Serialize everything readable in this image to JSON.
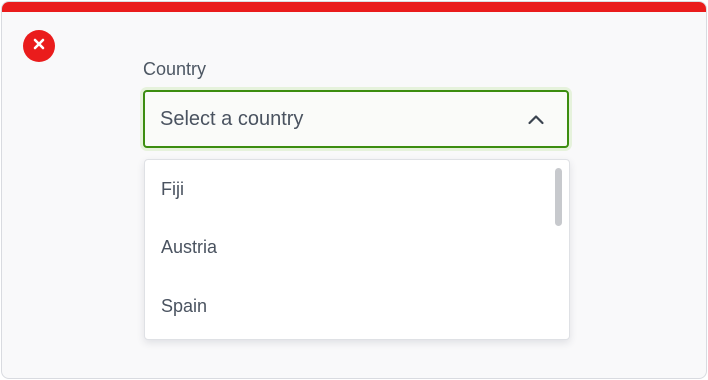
{
  "form": {
    "status_icon": "close-icon",
    "country_label": "Country",
    "select": {
      "value": "Select a country",
      "expanded": true,
      "chevron_icon": "chevron-up-icon"
    },
    "options": [
      {
        "label": "Fiji"
      },
      {
        "label": "Austria"
      },
      {
        "label": "Spain"
      }
    ]
  },
  "colors": {
    "error": "#ea1c1c",
    "focus_border": "#3c8d10",
    "text": "#4a5360"
  }
}
